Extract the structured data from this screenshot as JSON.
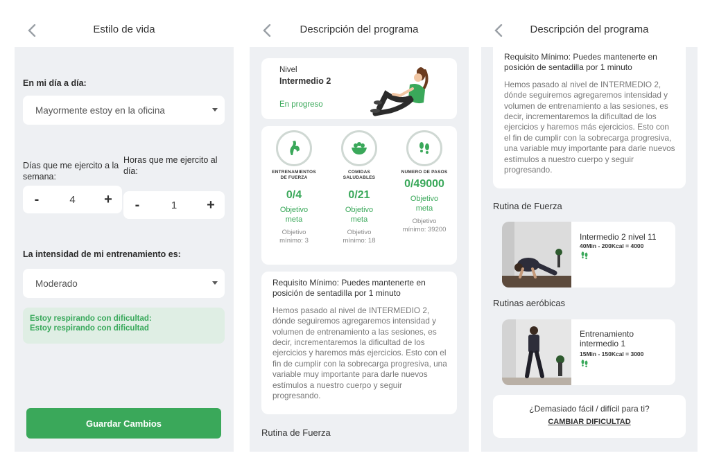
{
  "screen1": {
    "title": "Estilo de vida",
    "daily_label": "En mi día a día:",
    "daily_select": "Mayormente estoy en la oficina",
    "days_label": "Días que me ejercito a la semana:",
    "days_value": "4",
    "hours_label": "Horas que me ejercito al día:",
    "hours_value": "1",
    "minus": "-",
    "plus": "+",
    "intensity_label": "La intensidad de mi entrenamiento es:",
    "intensity_select": "Moderado",
    "info_line1": "Estoy respirando con dificultad:",
    "info_line2": "Estoy respirando con dificultad",
    "save_button": "Guardar Cambios"
  },
  "screen2": {
    "title": "Descripción del programa",
    "level_label": "Nivel",
    "level_name": "Intermedio 2",
    "status": "En progreso",
    "stats": [
      {
        "name1": "ENTRENAMIENTOS",
        "name2": "DE FUERZA",
        "value": "0/4",
        "goal1": "Objetivo",
        "goal2": "meta",
        "min1": "Objetivo",
        "min2": "mínimo: 3",
        "icon": "arm-icon"
      },
      {
        "name1": "COMIDAS",
        "name2": "SALUDABLES",
        "value": "0/21",
        "goal1": "Objetivo",
        "goal2": "meta",
        "min1": "Objetivo",
        "min2": "mínimo: 18",
        "icon": "salad-bowl-icon"
      },
      {
        "name1": "NUMERO DE PASOS",
        "name2": "",
        "value": "0/49000",
        "goal1": "Objetivo",
        "goal2": "meta",
        "min1": "Objetivo",
        "min2": "mínimo: 39200",
        "icon": "footprints-icon"
      }
    ],
    "requirement": "Requisito Mínimo: Puedes mantenerte en posición de sentadilla por 1 minuto",
    "description": "Hemos pasado al nivel de INTERMEDIO 2, dónde seguiremos agregaremos intensidad y volumen de entrenamiento a las sesiones, es decir, incrementaremos la dificultad de los ejercicios y haremos más ejercicios. Esto con el fin de cumplir con la sobrecarga progresiva, una variable muy importante para darle nuevos estímulos a nuestro cuerpo y seguir progresando.",
    "strength_title": "Rutina de Fuerza"
  },
  "screen3": {
    "title": "Descripción del programa",
    "req_cut_line": "Requisito Mínimo: Puedes mantenerte en",
    "req_line2": "posición de sentadilla por 1 minuto",
    "description": "Hemos pasado al nivel de INTERMEDIO 2, dónde seguiremos agregaremos intensidad y volumen de entrenamiento a las sesiones, es decir, incrementaremos la dificultad de los ejercicios y haremos más ejercicios. Esto con el fin de cumplir con la sobrecarga progresiva, una variable muy importante para darle nuevos estímulos a nuestro cuerpo y seguir progresando.",
    "strength_title": "Rutina de Fuerza",
    "routine1_name": "Intermedio 2 nivel 11",
    "routine1_meta": "40Min - 200Kcal = 4000",
    "aerobic_title": "Rutinas aeróbicas",
    "routine2_name": "Entrenamiento intermedio 1",
    "routine2_meta": "15Min - 150Kcal = 3000",
    "difficulty_question": "¿Demasiado fácil / difícil para ti?",
    "difficulty_link": "CAMBIAR DIFICULTAD"
  },
  "colors": {
    "accent_green": "#3aa85a",
    "background": "#eef0f3",
    "card": "#ffffff",
    "info_box": "#dfeee4"
  }
}
